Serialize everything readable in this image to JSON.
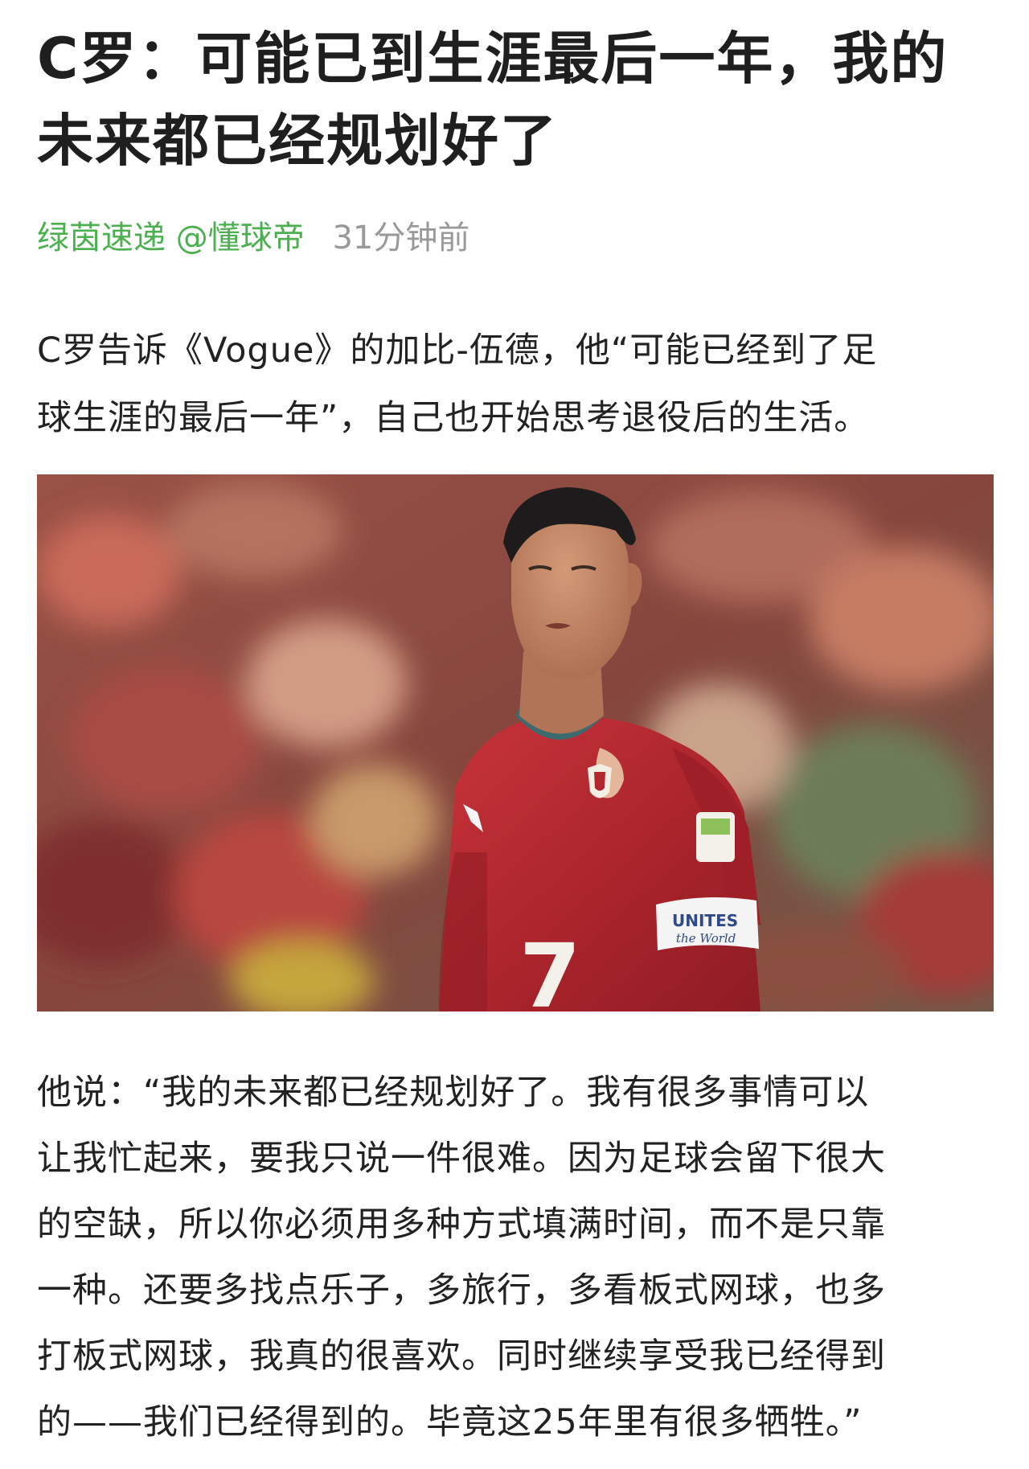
{
  "article": {
    "title_lines": [
      "C罗：可能已到生涯最后一年，我的",
      "未来都已经规划好了"
    ],
    "source": "绿茵速递 @懂球帝",
    "time": "31分钟前",
    "lead_lines": [
      "C罗告诉《Vogue》的加比-伍德，他“可能已经到了足",
      "球生涯的最后一年”，自己也开始思考退役后的生活。"
    ],
    "photo": {
      "jersey_number": "7",
      "armband_text": [
        "UNITES",
        "the World"
      ],
      "colors": {
        "jersey": "#b3262e",
        "background": "#8a4a40"
      }
    },
    "quote_lines": [
      "他说：“我的未来都已经规划好了。我有很多事情可以",
      "让我忙起来，要我只说一件很难。因为足球会留下很大",
      "的空缺，所以你必须用多种方式填满时间，而不是只靠",
      "一种。还要多找点乐子，多旅行，多看板式网球，也多",
      "打板式网球，我真的很喜欢。同时继续享受我已经得到",
      "的——我们已经得到的。毕竟这25年里有很多牺牲。”"
    ]
  }
}
